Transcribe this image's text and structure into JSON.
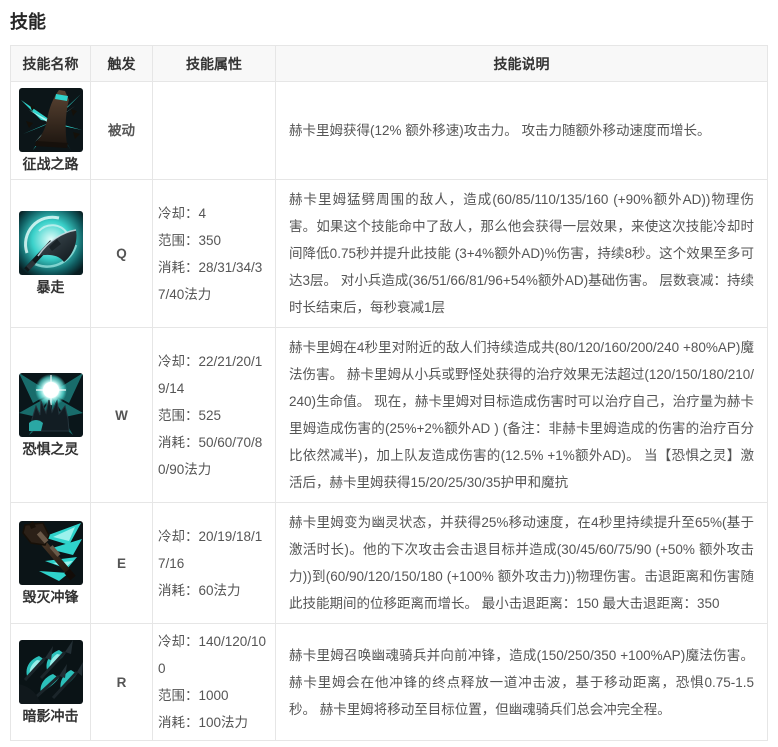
{
  "page": {
    "title": "技能"
  },
  "colors": {
    "accent_teal": "#2fd3cc",
    "header_bg": "#f8f8f8",
    "border": "#e6e6e6",
    "text": "#555555",
    "text_strong": "#333333"
  },
  "table": {
    "headers": [
      "技能名称",
      "触发",
      "技能属性",
      "技能说明"
    ],
    "rows": [
      {
        "name": "征战之路",
        "icon": "warpath-hoof-icon",
        "trigger": "被动",
        "attributes": [],
        "description": "赫卡里姆获得(12% 额外移速)攻击力。 攻击力随额外移动速度而增长。"
      },
      {
        "name": "暴走",
        "icon": "rampage-halberd-icon",
        "trigger": "Q",
        "attributes": [
          "冷却：4",
          "范围：350",
          "消耗：28/31/34/37/40法力"
        ],
        "description": "赫卡里姆猛劈周围的敌人，造成(60/85/110/135/160 (+90%额外AD))物理伤害。如果这个技能命中了敌人，那么他会获得一层效果，来使这次技能冷却时间降低0.75秒并提升此技能 (3+4%额外AD)%伤害，持续8秒。这个效果至多可达3层。 对小兵造成(36/51/66/81/96+54%额外AD)基础伤害。 层数衰减：持续时长结束后，每秒衰减1层"
      },
      {
        "name": "恐惧之灵",
        "icon": "spirit-of-dread-hand-icon",
        "trigger": "W",
        "attributes": [
          "冷却：22/21/20/19/14",
          "范围：525",
          "消耗：50/60/70/80/90法力"
        ],
        "description": "赫卡里姆在4秒里对附近的敌人们持续造成共(80/120/160/200/240 +80%AP)魔法伤害。 赫卡里姆从小兵或野怪处获得的治疗效果无法超过(120/150/180/210/240)生命值。 现在，赫卡里姆对目标造成伤害时可以治疗自己，治疗量为赫卡里姆造成伤害的(25%+2%额外AD ) (备注：非赫卡里姆造成的伤害的治疗百分比依然减半)，加上队友造成伤害的(12.5% +1%额外AD)。 当【恐惧之灵】激活后，赫卡里姆获得15/20/25/30/35护甲和魔抗"
      },
      {
        "name": "毁灭冲锋",
        "icon": "devastating-charge-mace-icon",
        "trigger": "E",
        "attributes": [
          "冷却：20/19/18/17/16",
          "消耗：60法力"
        ],
        "description": "赫卡里姆变为幽灵状态，并获得25%移动速度，在4秒里持续提升至65%(基于激活时长)。他的下次攻击会击退目标并造成(30/45/60/75/90 (+50% 额外攻击力))到(60/90/120/150/180 (+100% 额外攻击力))物理伤害。击退距离和伤害随此技能期间的位移距离而增长。 最小击退距离：150 最大击退距离：350"
      },
      {
        "name": "暗影冲击",
        "icon": "onslaught-of-shadows-lances-icon",
        "trigger": "R",
        "attributes": [
          "冷却：140/120/100",
          "范围：1000",
          "消耗：100法力"
        ],
        "description": "赫卡里姆召唤幽魂骑兵并向前冲锋，造成(150/250/350 +100%AP)魔法伤害。赫卡里姆会在他冲锋的终点释放一道冲击波，基于移动距离，恐惧0.75-1.5秒。 赫卡里姆将移动至目标位置，但幽魂骑兵们总会冲完全程。"
      }
    ]
  }
}
